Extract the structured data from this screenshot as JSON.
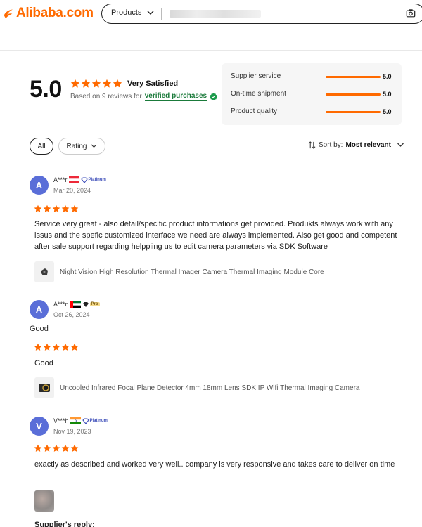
{
  "header": {
    "logo_text": "Alibaba.com",
    "search_category": "Products",
    "accent_color": "#ff6a00"
  },
  "summary": {
    "score": "5.0",
    "rating_label": "Very Satisfied",
    "based_on": "Based on 9 reviews for",
    "verified": "verified purchases",
    "stars": 5
  },
  "metrics": [
    {
      "label": "Supplier service",
      "value": "5.0",
      "fraction": 1.0
    },
    {
      "label": "On-time shipment",
      "value": "5.0",
      "fraction": 1.0
    },
    {
      "label": "Product quality",
      "value": "5.0",
      "fraction": 1.0
    }
  ],
  "filters": {
    "all_label": "All",
    "rating_label": "Rating",
    "sort_prefix": "Sort by:",
    "sort_value": "Most relevant"
  },
  "reviews": [
    {
      "initial": "A",
      "name": "A***r",
      "flag": "austria",
      "badge": "Platinum",
      "date": "Mar 20, 2024",
      "stars": 5,
      "text": "Service very great - also detail/specific product informations get provided. Produkts always work with any issus and the spefic customized interface we need are always implemented. Also get good and competent after sale support regarding helppiing us to edit camera parameters via SDK Software",
      "product": "Night Vision High Resolution Thermal Imager Camera Thermal Imaging Module Core"
    },
    {
      "initial": "A",
      "name": "A***n",
      "flag": "uae",
      "badge": "Pro",
      "date": "Oct 26, 2024",
      "title": "Good",
      "stars": 5,
      "text": "Good",
      "product": "Uncooled Infrared Focal Plane Detector 4mm 18mm Lens SDK IP Wifi Thermal Imaging Camera"
    },
    {
      "initial": "V",
      "name": "V***h",
      "flag": "india",
      "badge": "Platinum",
      "date": "Nov 19, 2023",
      "stars": 5,
      "text": "exactly as described and worked very well.. company is very responsive and takes care to deliver on time",
      "reply_label": "Supplier's reply:"
    }
  ]
}
